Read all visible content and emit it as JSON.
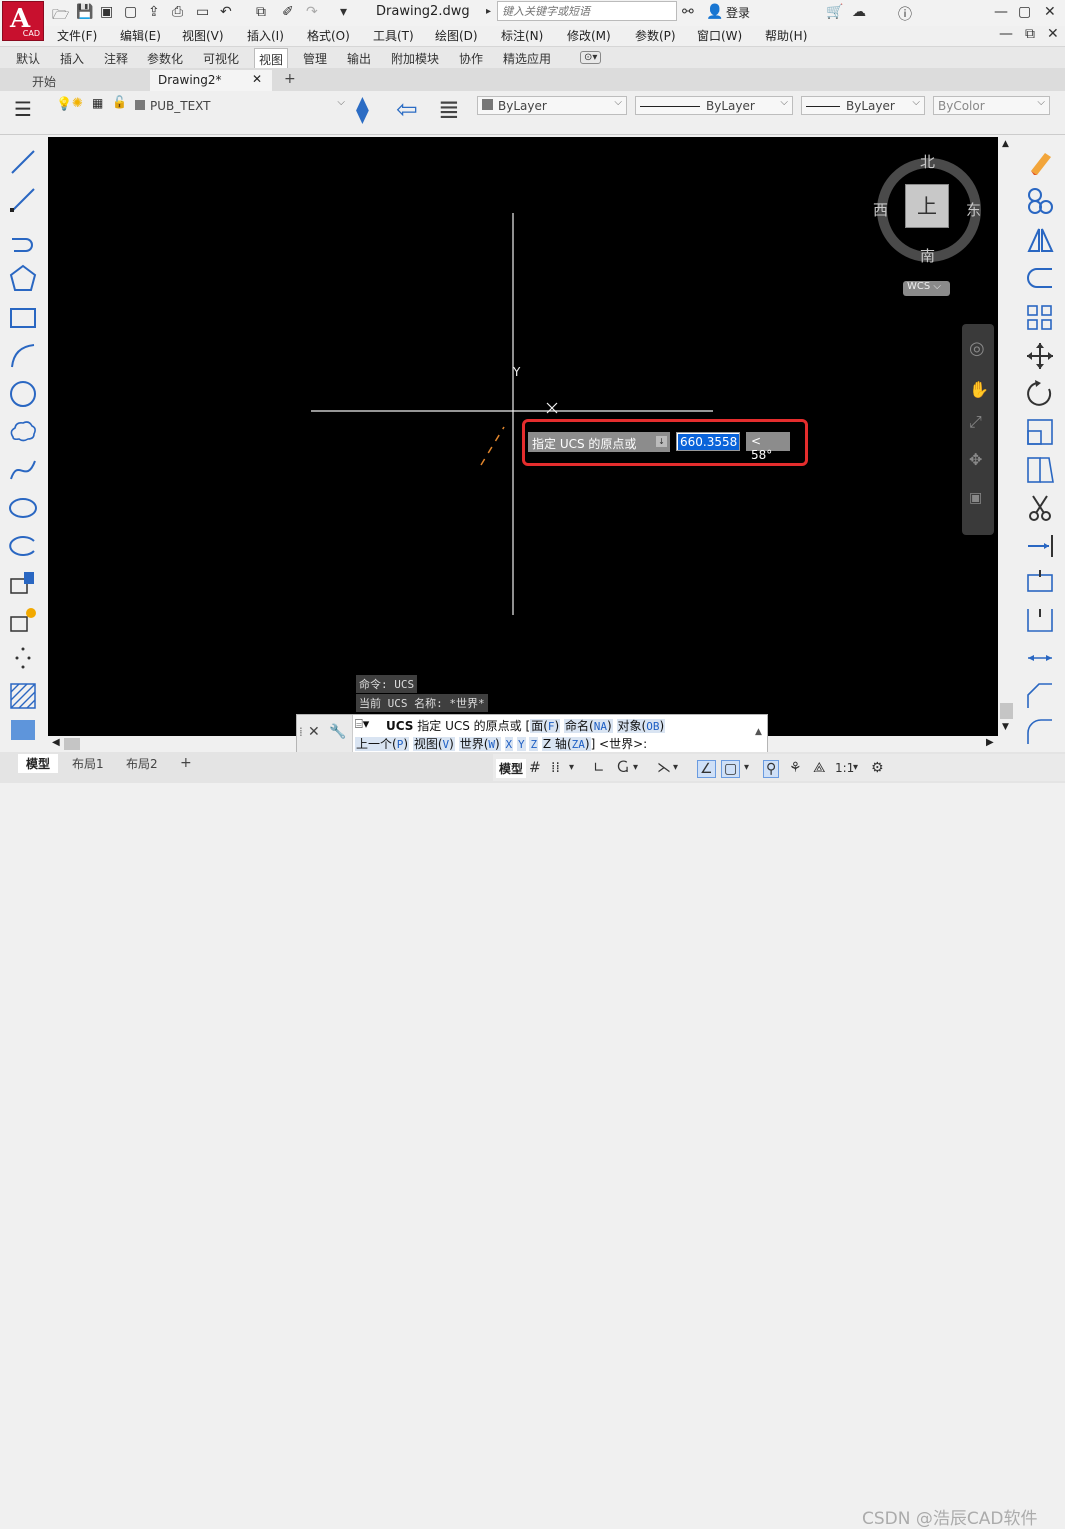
{
  "app": {
    "logo_letter": "A",
    "logo_sub": "CAD",
    "doc_title": "Drawing2.dwg",
    "search_placeholder": "键入关键字或短语",
    "login": "登录"
  },
  "menu": [
    "文件(F)",
    "编辑(E)",
    "视图(V)",
    "插入(I)",
    "格式(O)",
    "工具(T)",
    "绘图(D)",
    "标注(N)",
    "修改(M)",
    "参数(P)",
    "窗口(W)",
    "帮助(H)"
  ],
  "ribbon_tabs": [
    "默认",
    "插入",
    "注释",
    "参数化",
    "可视化",
    "视图",
    "管理",
    "输出",
    "附加模块",
    "协作",
    "精选应用"
  ],
  "file_tabs": {
    "start": "开始",
    "drawing": "Drawing2*",
    "add": "+"
  },
  "toolbar": {
    "layer": "PUB_TEXT",
    "color": "ByLayer",
    "linetype": "ByLayer",
    "lineweight": "ByLayer",
    "plotstyle": "ByColor"
  },
  "viewcube": {
    "north": "北",
    "south": "南",
    "east": "东",
    "west": "西",
    "top": "上",
    "ucs": "WCS"
  },
  "ucs_icon": {
    "y_label": "Y"
  },
  "dynamic_input": {
    "prompt": "指定 UCS 的原点或",
    "value": "660.3558",
    "angle": "< 58°"
  },
  "history": {
    "line1": "命令: UCS",
    "line2": "当前 UCS 名称: *世界*"
  },
  "command": {
    "name": "UCS",
    "prompt": "指定 UCS 的原点或",
    "bracket_open": "[",
    "options_line1": [
      {
        "label": "面",
        "key": "F"
      },
      {
        "label": "命名",
        "key": "NA"
      },
      {
        "label": "对象",
        "key": "OB"
      }
    ],
    "options_line2": [
      {
        "label": "上一个",
        "key": "P"
      },
      {
        "label": "视图",
        "key": "V"
      },
      {
        "label": "世界",
        "key": "W"
      },
      {
        "label": "",
        "key": "X"
      },
      {
        "label": "",
        "key": "Y"
      },
      {
        "label": "",
        "key": "Z"
      },
      {
        "label": "Z 轴",
        "key": "ZA"
      }
    ],
    "default": "] <世界>:"
  },
  "status": {
    "model_tab": "模型",
    "layout1": "布局1",
    "layout2": "布局2",
    "add": "+",
    "model_label": "模型",
    "scale": "1:1"
  },
  "watermark": "CSDN @浩辰CAD软件",
  "colors": {
    "highlight": "#e52d2d",
    "canvas": "#000000",
    "selection": "#0a63d9"
  }
}
